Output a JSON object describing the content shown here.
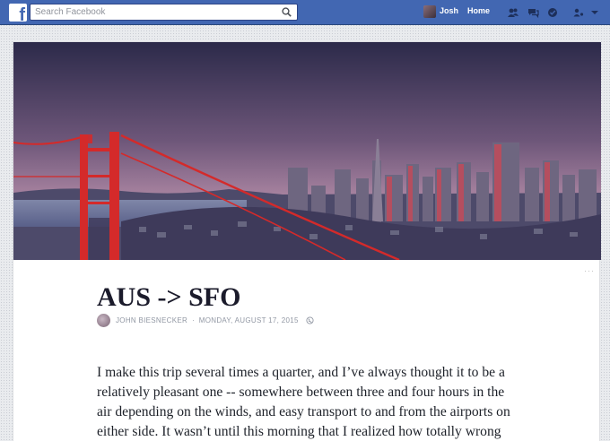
{
  "topbar": {
    "logo": "f",
    "search_placeholder": "Search Facebook",
    "user_name": "Josh",
    "home_label": "Home",
    "icons": [
      "friend-requests-icon",
      "messages-icon",
      "notifications-icon",
      "privacy-shortcuts-icon",
      "account-menu-icon"
    ]
  },
  "post": {
    "title": "AUS -> SFO",
    "author": "JOHN BIESNECKER",
    "separator": "·",
    "date": "MONDAY, AUGUST 17, 2015",
    "privacy_icon": "globe-icon",
    "more": "···",
    "body": "I make this trip several times a quarter, and I’ve always thought it to be a relatively pleasant one -- somewhere between three and four hours in the air depending on the winds, and easy transport to and from the airports on either side. It wasn’t until this morning that I realized how totally wrong that is."
  },
  "colors": {
    "brand": "#4267b2",
    "bridge": "#d42a2a",
    "sky_top": "#2c2a4a",
    "sky_bottom": "#b18aa6"
  }
}
